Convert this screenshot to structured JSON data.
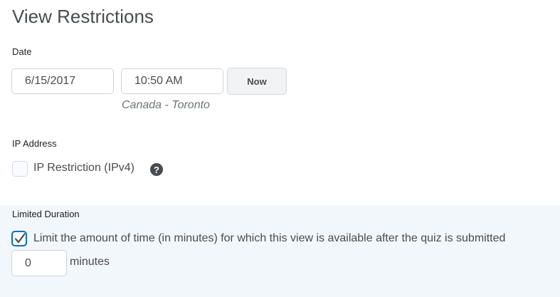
{
  "header": {
    "title": "View Restrictions"
  },
  "date_section": {
    "label": "Date",
    "date_value": "6/15/2017",
    "time_value": "10:50 AM",
    "now_button": "Now",
    "timezone": "Canada - Toronto"
  },
  "ip_section": {
    "label": "IP Address",
    "restriction_label": "IP Restriction (IPv4)",
    "restriction_checked": false,
    "help_icon": "help-icon"
  },
  "duration_section": {
    "label": "Limited Duration",
    "limit_label": "Limit the amount of time (in minutes) for which this view is available after the quiz is submitted",
    "limit_checked": true,
    "minutes_value": "0",
    "minutes_unit": "minutes"
  },
  "colors": {
    "panel_bg": "#f1f7fb",
    "checkbox_accent": "#006fbf",
    "text": "#494c4e"
  }
}
